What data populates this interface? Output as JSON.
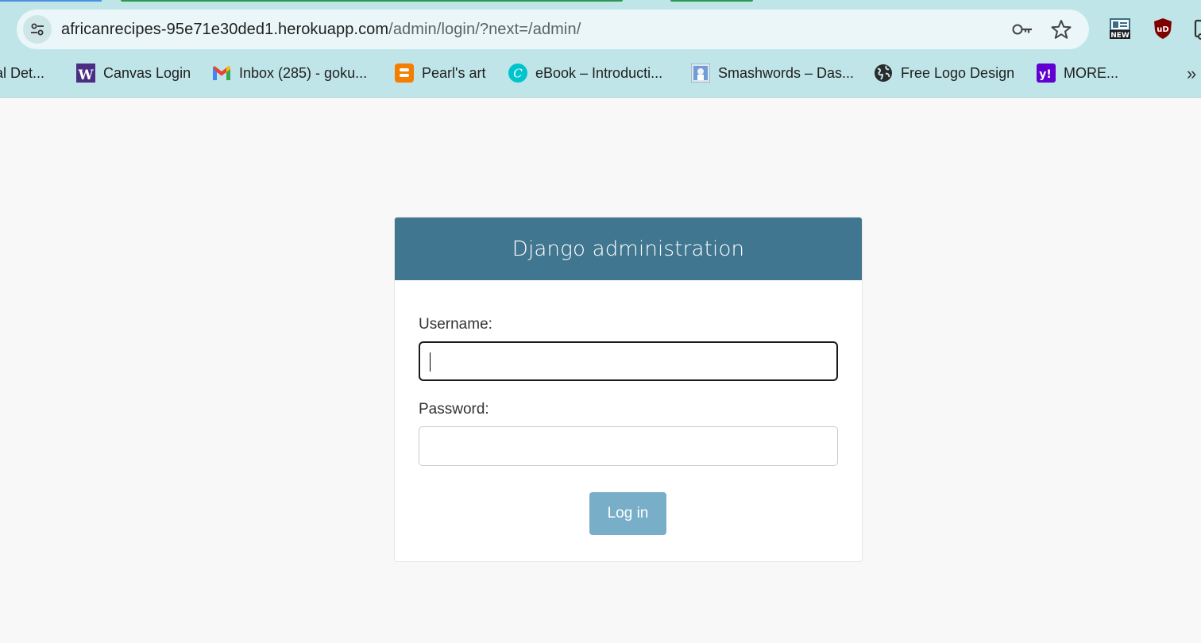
{
  "browser": {
    "url_host": "africanrecipes-95e71e30ded1.herokuapp.com",
    "url_path": "/admin/login/?next=/admin/",
    "icons": {
      "site_info": "tune-icon",
      "password": "key-icon",
      "bookmark": "star-icon",
      "extensions": [
        "news-new-icon",
        "ublock-shield-icon",
        "puzzle-icon"
      ]
    },
    "extension_labels": {
      "new_badge": "NEW",
      "ublock": "uD"
    },
    "bookmarks": [
      {
        "label": "al Det...",
        "icon": "generic-icon"
      },
      {
        "label": "Canvas Login",
        "icon": "w-logo-icon",
        "glyph": "W"
      },
      {
        "label": "Inbox (285) - goku...",
        "icon": "gmail-icon"
      },
      {
        "label": "Pearl's art",
        "icon": "blogger-icon"
      },
      {
        "label": "eBook – Introducti...",
        "icon": "canva-icon",
        "glyph": "C"
      },
      {
        "label": "Smashwords – Das...",
        "icon": "smashwords-icon"
      },
      {
        "label": "Free Logo Design",
        "icon": "globe-icon"
      },
      {
        "label": "MORE...",
        "icon": "yahoo-icon",
        "glyph": "y!"
      }
    ],
    "overflow": "»"
  },
  "login": {
    "title": "Django administration",
    "username_label": "Username:",
    "username_value": "",
    "password_label": "Password:",
    "password_value": "",
    "submit_label": "Log in"
  },
  "colors": {
    "chrome_bg": "#bfe5e9",
    "header_bg": "#417690",
    "button_bg": "#79aec8",
    "page_bg": "#f8f8f8"
  }
}
